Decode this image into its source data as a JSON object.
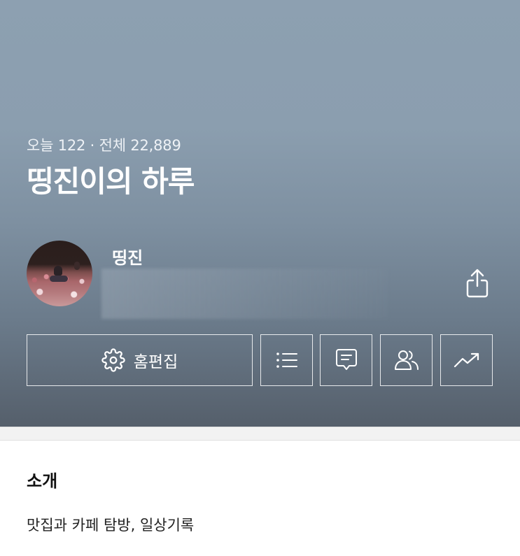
{
  "header": {
    "visits": "오늘 122 · 전체 22,889",
    "blog_title": "띵진이의 하루"
  },
  "profile": {
    "username": "띵진",
    "avatar_icon": "profile-photo"
  },
  "actions": {
    "home_edit_label": "홈편집",
    "icons": [
      "gear-icon",
      "list-icon",
      "comment-icon",
      "neighbors-icon",
      "stats-icon",
      "share-icon"
    ]
  },
  "intro": {
    "heading": "소개",
    "text": "맛집과 카페 탐방, 일상기록"
  },
  "colors": {
    "hero_top": "#8da0b1",
    "hero_bottom": "#555f6b",
    "text_white": "#ffffff"
  }
}
